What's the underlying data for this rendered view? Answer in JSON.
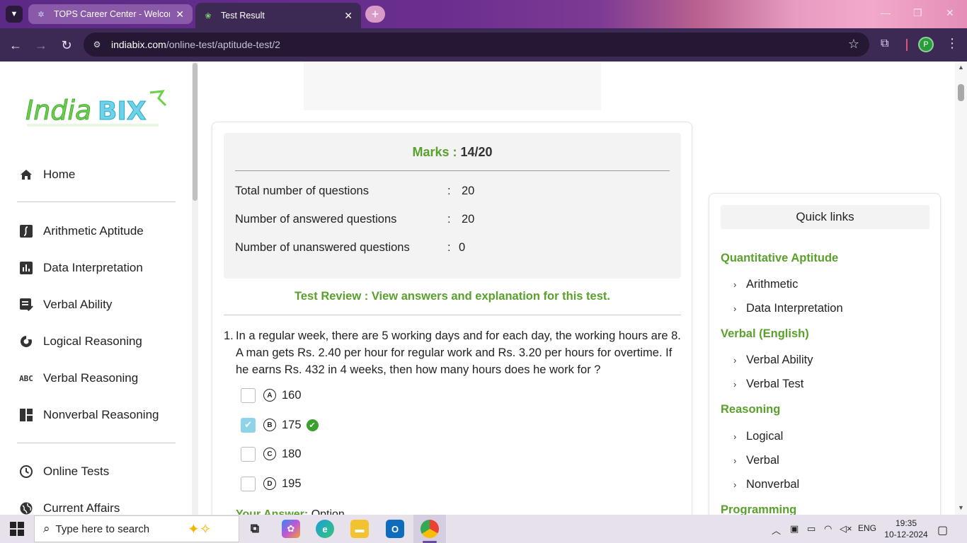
{
  "browser": {
    "tabs": [
      {
        "title": "TOPS Career Center - Welcome",
        "active": false
      },
      {
        "title": "Test Result",
        "active": true
      }
    ],
    "url_domain": "indiabix.com",
    "url_path": "/online-test/aptitude-test/2",
    "profile_initial": "P"
  },
  "sidebar": {
    "logo_text": "IndiaBIX",
    "items": [
      {
        "label": "Home",
        "icon": "home-icon"
      },
      {
        "label": "Arithmetic Aptitude",
        "icon": "integral-icon"
      },
      {
        "label": "Data Interpretation",
        "icon": "bar-chart-icon"
      },
      {
        "label": "Verbal Ability",
        "icon": "checklist-icon"
      },
      {
        "label": "Logical Reasoning",
        "icon": "logic-icon"
      },
      {
        "label": "Verbal Reasoning",
        "icon": "abc-icon"
      },
      {
        "label": "Nonverbal Reasoning",
        "icon": "grid-icon"
      },
      {
        "label": "Online Tests",
        "icon": "clock-icon"
      },
      {
        "label": "Current Affairs",
        "icon": "globe-icon"
      }
    ],
    "abc_glyph": "ABC"
  },
  "result": {
    "marks_label": "Marks :",
    "marks_value": "14/20",
    "rows": [
      {
        "label": "Total number of questions",
        "colon": ":",
        "value": "20"
      },
      {
        "label": "Number of answered questions",
        "colon": ":",
        "value": "20"
      },
      {
        "label": "Number of unanswered questions",
        "colon": ":",
        "value": "0"
      }
    ],
    "review_text": "Test Review : View answers and explanation for this test."
  },
  "question": {
    "number": "1.",
    "text": "In a regular week, there are 5 working days and for each day, the working hours are 8. A man gets Rs. 2.40 per hour for regular work and Rs. 3.20 per hours for overtime. If he earns Rs. 432 in 4 weeks, then how many hours does he work for ?",
    "options": [
      {
        "letter": "A",
        "value": "160",
        "checked": false,
        "correct": false
      },
      {
        "letter": "B",
        "value": "175",
        "checked": true,
        "correct": true
      },
      {
        "letter": "C",
        "value": "180",
        "checked": false,
        "correct": false
      },
      {
        "letter": "D",
        "value": "195",
        "checked": false,
        "correct": false
      }
    ],
    "your_answer_label": "Your Answer:",
    "your_answer_value": "Option"
  },
  "quick_links": {
    "title": "Quick links",
    "sections": [
      {
        "heading": "Quantitative Aptitude",
        "items": [
          "Arithmetic",
          "Data Interpretation"
        ]
      },
      {
        "heading": "Verbal (English)",
        "items": [
          "Verbal Ability",
          "Verbal Test"
        ]
      },
      {
        "heading": "Reasoning",
        "items": [
          "Logical",
          "Verbal",
          "Nonverbal"
        ]
      },
      {
        "heading": "Programming",
        "items": []
      }
    ]
  },
  "taskbar": {
    "search_placeholder": "Type here to search",
    "lang": "ENG",
    "time": "19:35",
    "date": "10-12-2024"
  },
  "colors": {
    "accent_green": "#5aa02c",
    "tab_bar": "#3c2a55",
    "check_blue": "#8ed3ea"
  }
}
